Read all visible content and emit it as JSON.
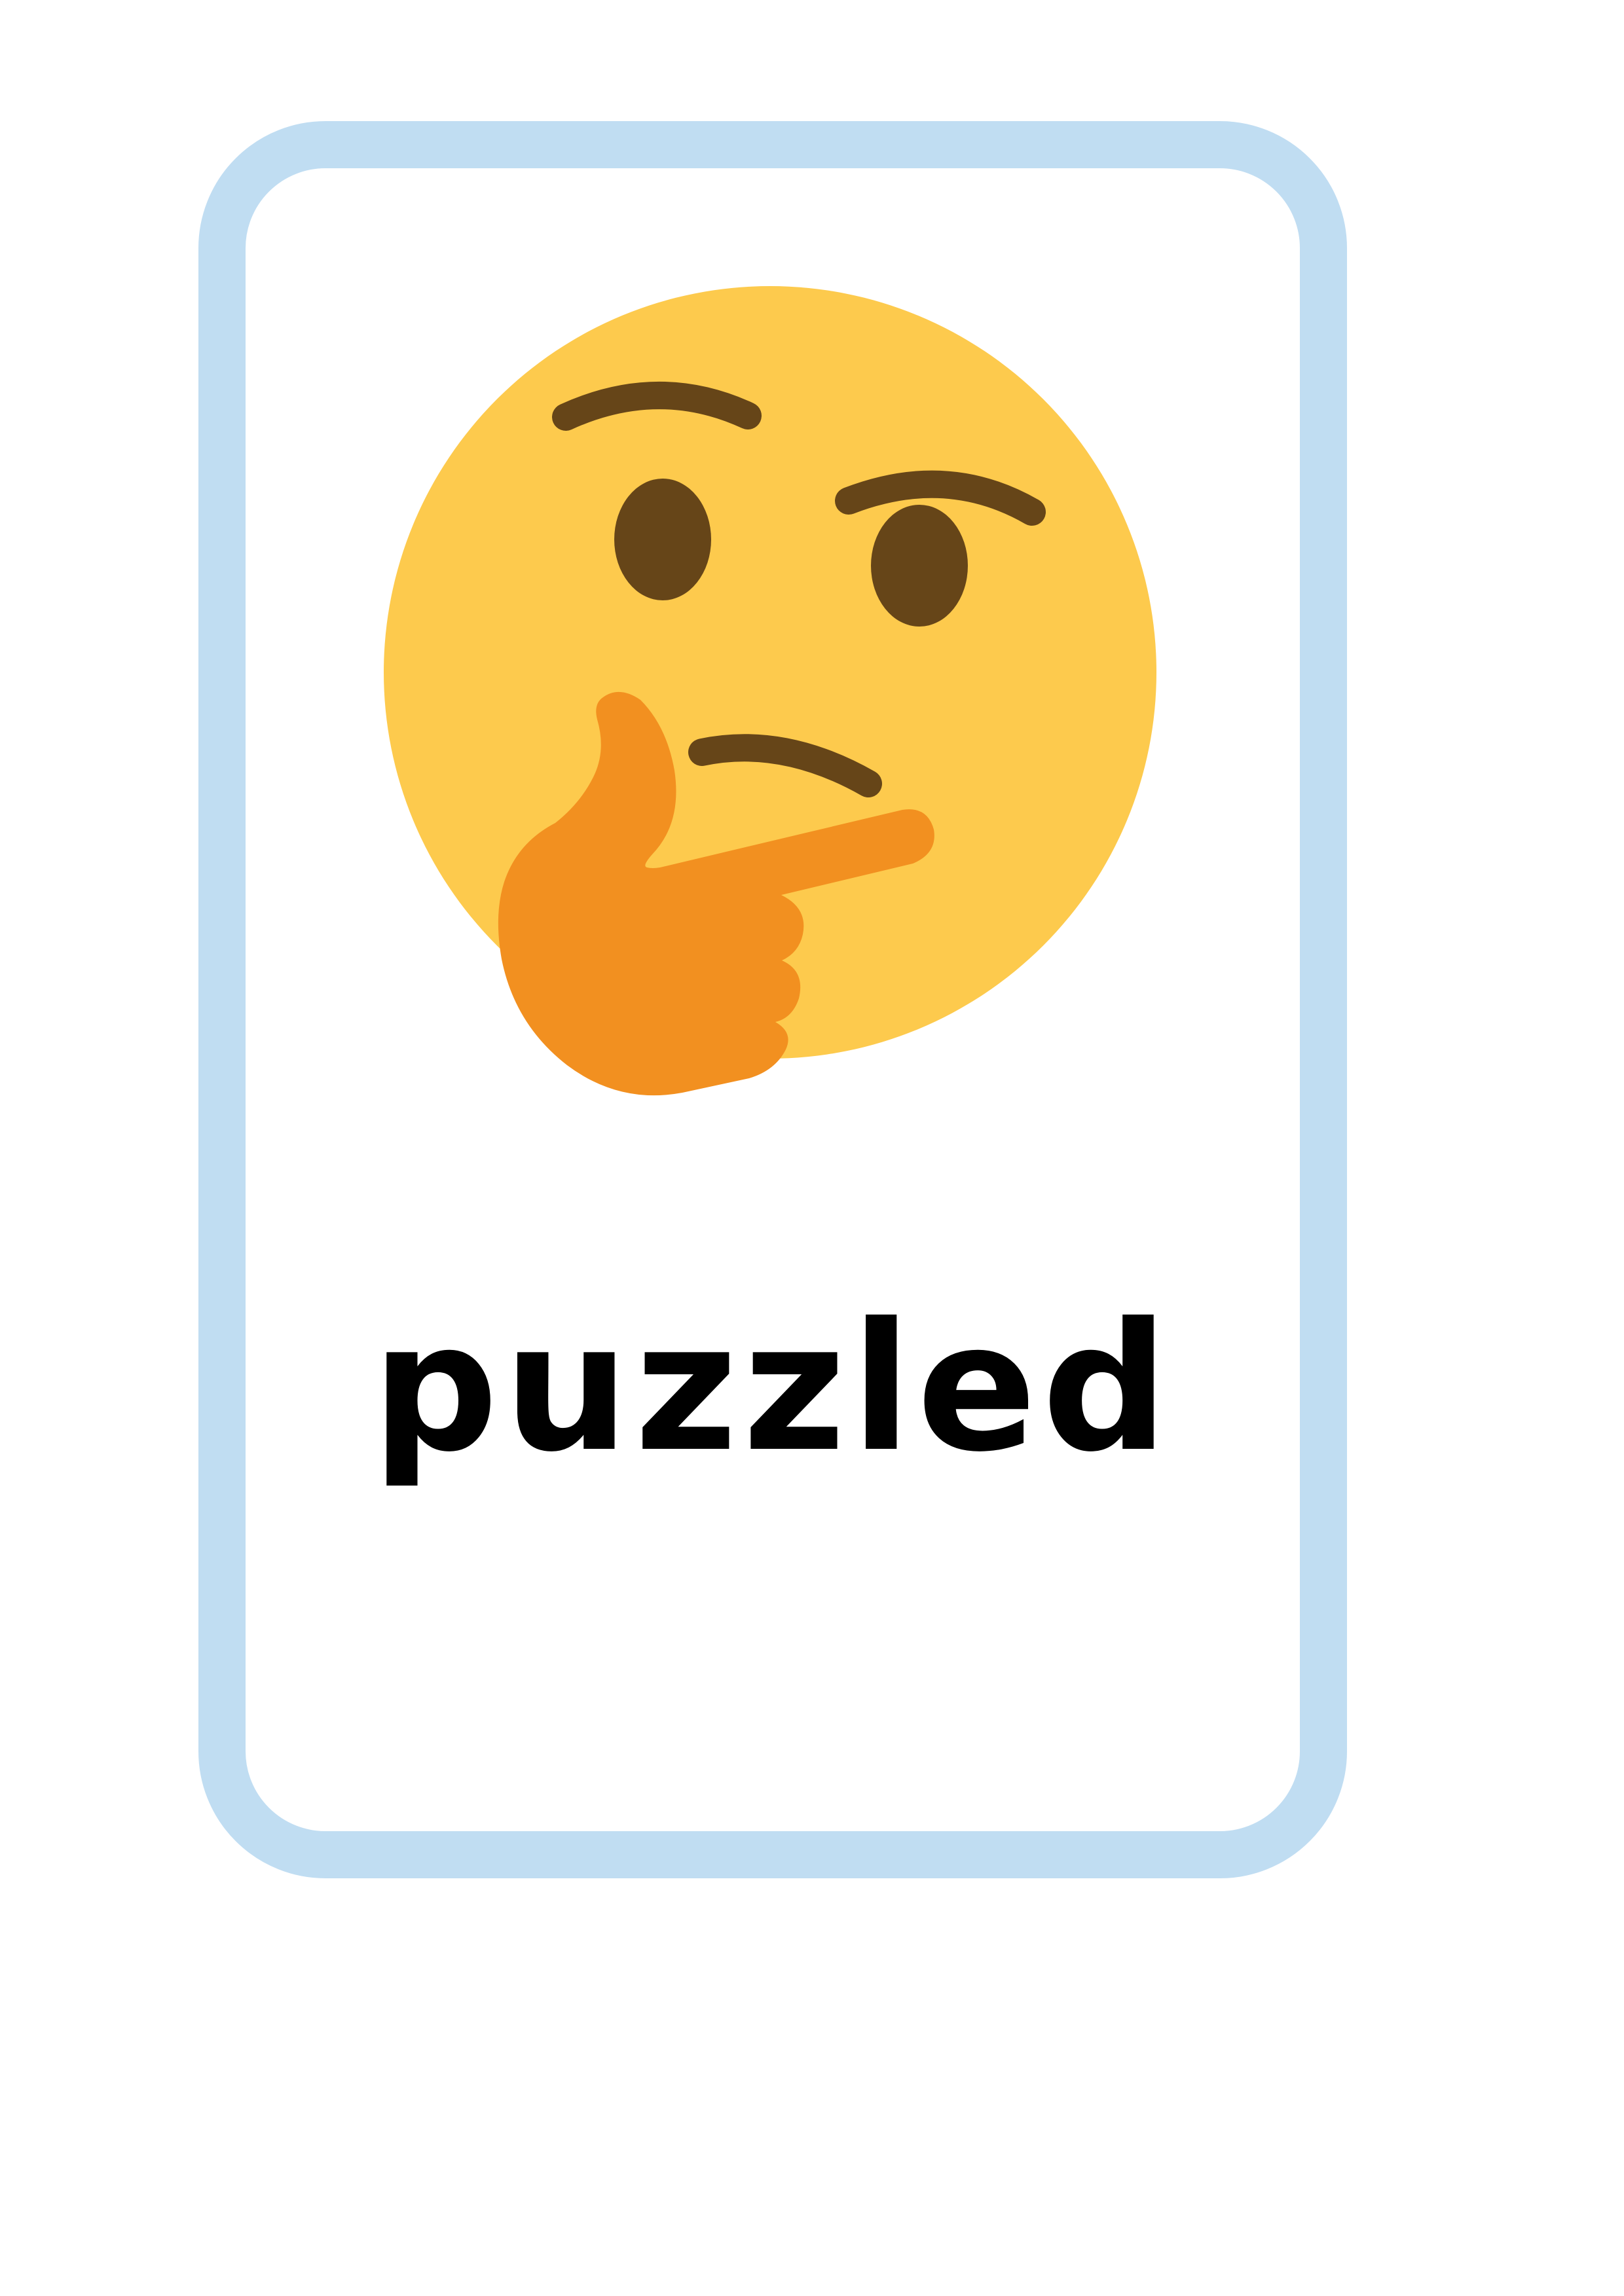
{
  "flashcard": {
    "word": "puzzled",
    "emoji_icon": "thinking-face-icon",
    "colors": {
      "border": "#c0ddf2",
      "face": "#fdca4d",
      "features": "#664518",
      "hand": "#f29020",
      "text": "#000000"
    }
  }
}
